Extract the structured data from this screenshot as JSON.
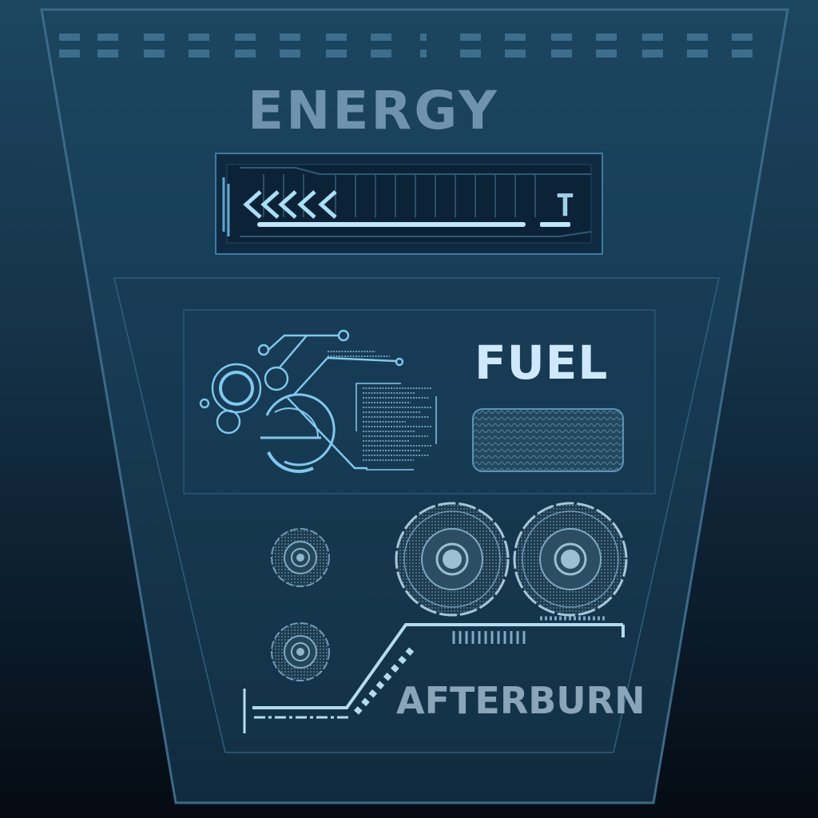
{
  "hud": {
    "energy": {
      "title": "ENERGY",
      "indicator_glyph": "T",
      "chevron_count": 5
    },
    "fuel": {
      "title": "FUEL"
    },
    "afterburn": {
      "title": "AFTERBURN"
    }
  },
  "colors": {
    "panel_fill": "#1a3f58",
    "panel_border": "#3e6d8c",
    "accent": "#9fd8f2",
    "gauge_fill": "#2a4d63"
  },
  "icons": [
    "chevron-left-icon",
    "circuit-decoration",
    "turbine-gauge-icon",
    "fuel-gauge-icon"
  ]
}
